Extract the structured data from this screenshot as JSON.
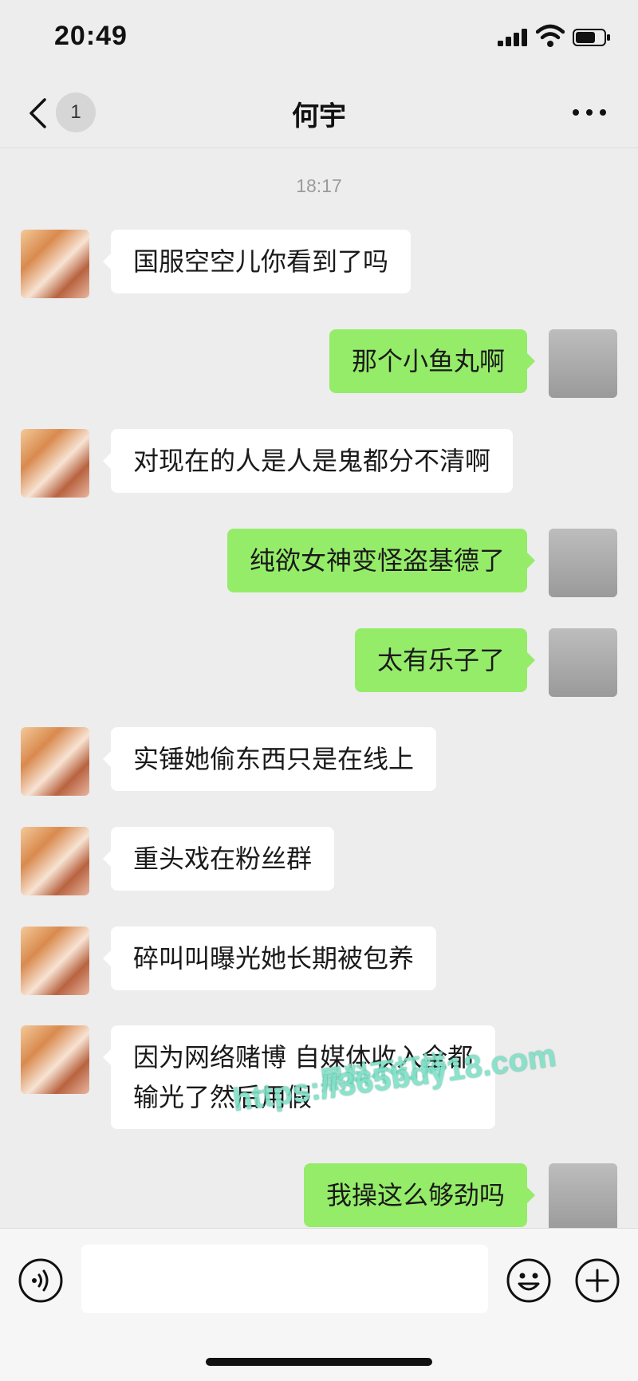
{
  "status_bar": {
    "time": "20:49"
  },
  "nav": {
    "unread_badge": "1",
    "title": "何宇"
  },
  "chat": {
    "timestamp": "18:17",
    "messages": [
      {
        "side": "left",
        "text": "国服空空儿你看到了吗"
      },
      {
        "side": "right",
        "text": "那个小鱼丸啊"
      },
      {
        "side": "left",
        "text": "对现在的人是人是鬼都分不清啊"
      },
      {
        "side": "right",
        "text": "纯欲女神变怪盗基德了"
      },
      {
        "side": "right",
        "text": "太有乐子了"
      },
      {
        "side": "left",
        "text": "实锤她偷东西只是在线上"
      },
      {
        "side": "left",
        "text": "重头戏在粉丝群"
      },
      {
        "side": "left",
        "text": "碎叫叫曝光她长期被包养"
      },
      {
        "side": "left",
        "line1": "因为网络赌博 自媒体收入全都",
        "line2": "输光了然后用假"
      },
      {
        "side": "right",
        "text": "我操这么够劲吗"
      }
    ]
  },
  "watermark": {
    "line1": "黑料不打烊",
    "line2": "https://365bdy18.com"
  },
  "input": {
    "value": ""
  }
}
